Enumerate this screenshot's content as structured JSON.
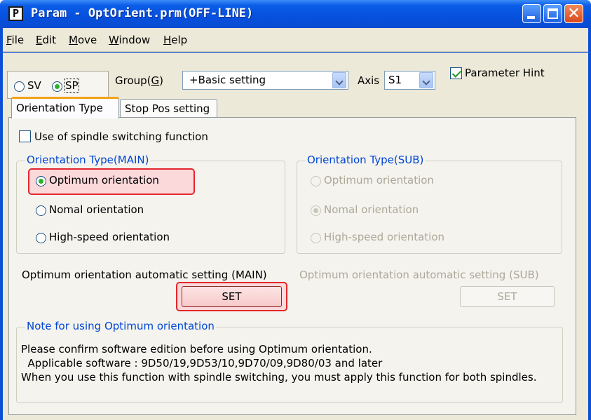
{
  "window": {
    "app_icon_letter": "P",
    "title": "Param - OptOrient.prm(OFF-LINE)"
  },
  "menu": [
    {
      "label": "File",
      "mnemonic": "F",
      "rest": "ile"
    },
    {
      "label": "Edit",
      "mnemonic": "E",
      "rest": "dit"
    },
    {
      "label": "Move",
      "mnemonic": "M",
      "rest": "ove"
    },
    {
      "label": "Window",
      "mnemonic": "W",
      "rest": "indow"
    },
    {
      "label": "Help",
      "mnemonic": "H",
      "rest": "elp"
    }
  ],
  "toolbar": {
    "sv_label": "SV",
    "sp_label": "SP",
    "selected_mode": "SP",
    "group_label_prefix": "Group(",
    "group_label_mnemonic": "G",
    "group_label_suffix": ")",
    "group_value": "+Basic setting",
    "axis_label": "Axis",
    "axis_value": "S1",
    "parameter_hint_label": "Parameter Hint",
    "parameter_hint_checked": true
  },
  "tabs": [
    {
      "label": "Orientation Type",
      "active": true
    },
    {
      "label": "Stop Pos setting",
      "active": false
    }
  ],
  "panel": {
    "spindle_switching_label": "Use of spindle switching function",
    "spindle_switching_checked": false,
    "main_group": {
      "title": "Orientation Type(MAIN)",
      "options": [
        "Optimum orientation",
        "Nomal orientation",
        "High-speed orientation"
      ],
      "selected": "Optimum orientation"
    },
    "sub_group": {
      "title": "Orientation Type(SUB)",
      "options": [
        "Optimum orientation",
        "Nomal orientation",
        "High-speed orientation"
      ],
      "selected": "Nomal orientation",
      "disabled": true
    },
    "auto_main_label": "Optimum orientation automatic setting (MAIN)",
    "auto_main_button": "SET",
    "auto_sub_label": "Optimum orientation automatic setting (SUB)",
    "auto_sub_button": "SET",
    "note": {
      "title": "Note for using Optimum orientation",
      "line1": "Please confirm software edition before using Optimum orientation.",
      "line2": "Applicable software : 9D50/19,9D53/10,9D70/09,9D80/03 and later",
      "line3": "When you use this function with spindle switching, you must apply this function for both spindles."
    }
  },
  "colors": {
    "titlebar": "#0a5ce6",
    "highlight_border": "#e3272c",
    "highlight_fill": "#fbd8d9",
    "group_title": "#0046d5",
    "radio_selected": "#2bb12e"
  }
}
